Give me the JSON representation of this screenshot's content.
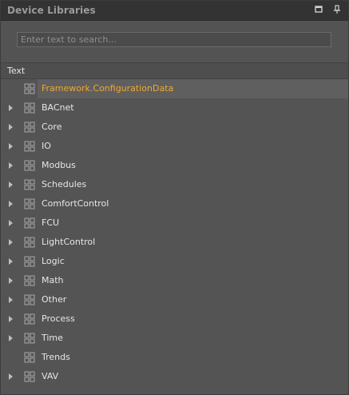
{
  "panel": {
    "title": "Device Libraries",
    "search_placeholder": "Enter text to search...",
    "search_value": "",
    "column_header": "Text"
  },
  "tree": {
    "items": [
      {
        "label": "Framework.ConfigurationData",
        "expandable": false,
        "selected": true
      },
      {
        "label": "BACnet",
        "expandable": true,
        "selected": false
      },
      {
        "label": "Core",
        "expandable": true,
        "selected": false
      },
      {
        "label": "IO",
        "expandable": true,
        "selected": false
      },
      {
        "label": "Modbus",
        "expandable": true,
        "selected": false
      },
      {
        "label": "Schedules",
        "expandable": true,
        "selected": false
      },
      {
        "label": "ComfortControl",
        "expandable": true,
        "selected": false
      },
      {
        "label": "FCU",
        "expandable": true,
        "selected": false
      },
      {
        "label": "LightControl",
        "expandable": true,
        "selected": false
      },
      {
        "label": "Logic",
        "expandable": true,
        "selected": false
      },
      {
        "label": "Math",
        "expandable": true,
        "selected": false
      },
      {
        "label": "Other",
        "expandable": true,
        "selected": false
      },
      {
        "label": "Process",
        "expandable": true,
        "selected": false
      },
      {
        "label": "Time",
        "expandable": true,
        "selected": false
      },
      {
        "label": "Trends",
        "expandable": false,
        "selected": false
      },
      {
        "label": "VAV",
        "expandable": true,
        "selected": false
      }
    ]
  },
  "colors": {
    "selected_text": "#f0a830",
    "text": "#e6e6e6",
    "panel_bg": "#545454"
  }
}
